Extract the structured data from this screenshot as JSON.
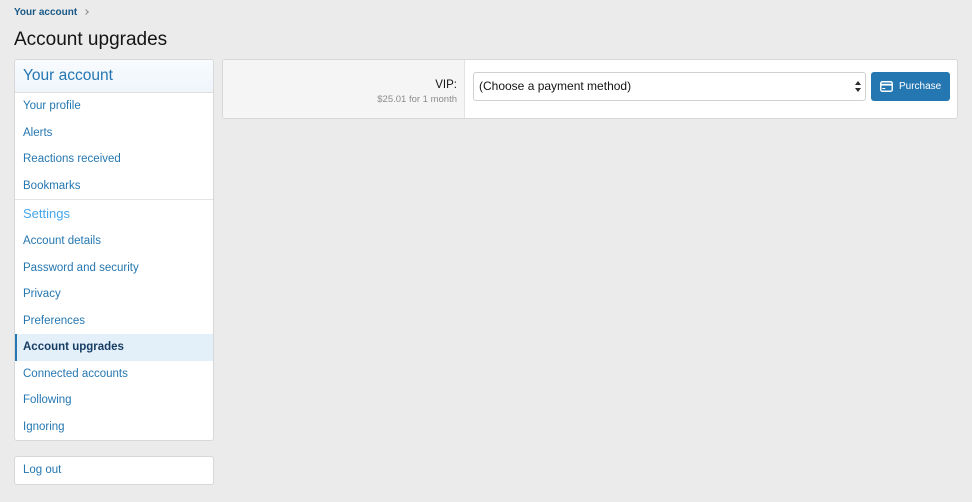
{
  "breadcrumb": {
    "items": [
      {
        "label": "Your account"
      }
    ]
  },
  "page": {
    "title": "Account upgrades"
  },
  "sidebar": {
    "header": "Your account",
    "account_items": [
      {
        "label": "Your profile"
      },
      {
        "label": "Alerts"
      },
      {
        "label": "Reactions received"
      },
      {
        "label": "Bookmarks"
      }
    ],
    "settings_header": "Settings",
    "settings_items": [
      {
        "label": "Account details"
      },
      {
        "label": "Password and security"
      },
      {
        "label": "Privacy"
      },
      {
        "label": "Preferences"
      },
      {
        "label": "Account upgrades",
        "selected": true
      },
      {
        "label": "Connected accounts"
      },
      {
        "label": "Following"
      },
      {
        "label": "Ignoring"
      }
    ]
  },
  "logout": {
    "label": "Log out"
  },
  "upgrades": [
    {
      "title": "VIP:",
      "price": "$25.01 for 1 month",
      "payment_method": {
        "value": "(Choose a payment method)"
      },
      "purchase_label": "Purchase"
    }
  ],
  "icons": {
    "breadcrumb_separator": "chevron-right-icon",
    "payment_select": "select-arrows-icon",
    "purchase_button": "credit-card-icon"
  },
  "colors": {
    "accent": "#2577b1",
    "breadcrumb": "#185886",
    "section_header": "#47a7eb",
    "selected_bg": "#e3f0fa",
    "muted_text": "#8c8c8c",
    "page_bg": "#ebebeb"
  }
}
